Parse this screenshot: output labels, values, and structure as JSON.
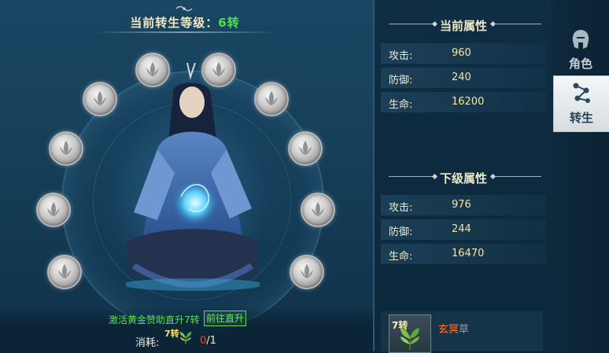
{
  "header": {
    "title_prefix": "当前转生等级：",
    "level": "6转"
  },
  "current": {
    "heading": "当前属性",
    "stats": [
      {
        "label": "攻击:",
        "value": "960"
      },
      {
        "label": "防御:",
        "value": "240"
      },
      {
        "label": "生命:",
        "value": "16200"
      }
    ]
  },
  "next": {
    "heading": "下级属性",
    "stats": [
      {
        "label": "攻击:",
        "value": "976"
      },
      {
        "label": "防御:",
        "value": "244"
      },
      {
        "label": "生命:",
        "value": "16470"
      }
    ]
  },
  "promo": {
    "text": "激活黄金赞助直升7转",
    "button": "前往直升"
  },
  "cost": {
    "label": "消耗:",
    "item_tag": "7转",
    "have": "0",
    "sep": "/",
    "need": "1"
  },
  "item": {
    "tag": "7转",
    "name": "玄冥草"
  },
  "tabs": [
    {
      "label": "角色",
      "icon": "helmet-icon"
    },
    {
      "label": "转生",
      "icon": "rebirth-nodes-icon"
    }
  ],
  "nodes_count_visible": "10",
  "colors": {
    "level_green": "#4fe04f",
    "value_gold": "#f4e3a0",
    "item_orange": "#ff7a3b",
    "have_red": "#ff3b30"
  }
}
